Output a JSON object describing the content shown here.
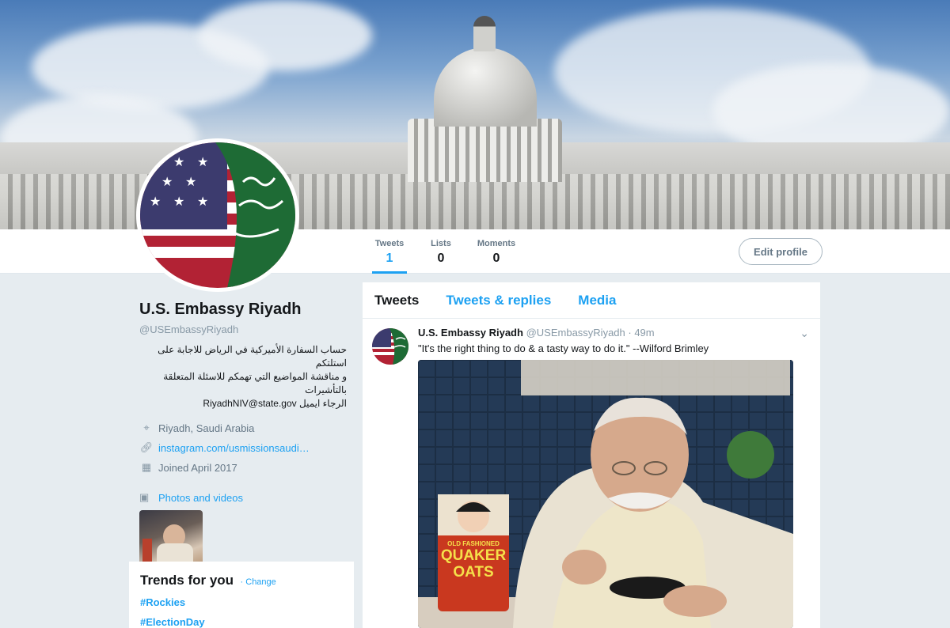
{
  "profile": {
    "name": "U.S. Embassy Riyadh",
    "handle": "@USEmbassyRiyadh",
    "bio_line1": "حساب السفارة الأميركية في الرياض للاجابة على استلتكم",
    "bio_line2": "و مناقشة المواضيع التي تهمكم للاسئلة المتعلقة بالتأشيرات",
    "bio_line3": "الرجاء ايميل RiyadhNIV@state.gov",
    "location": "Riyadh, Saudi Arabia",
    "website": "instagram.com/usmissionsaudi…",
    "joined": "Joined April 2017",
    "photos_label": "Photos and videos"
  },
  "nav": {
    "stats": [
      {
        "label": "Tweets",
        "value": "1"
      },
      {
        "label": "Lists",
        "value": "0"
      },
      {
        "label": "Moments",
        "value": "0"
      }
    ],
    "edit_profile": "Edit profile"
  },
  "timeline": {
    "tabs": [
      "Tweets",
      "Tweets & replies",
      "Media"
    ]
  },
  "tweet": {
    "name": "U.S. Embassy Riyadh",
    "handle": "@USEmbassyRiyadh",
    "time": "· 49m",
    "text": "\"It's the right thing to do & a tasty way to do it.\" --Wilford Brimley"
  },
  "media": {
    "can_line1": "OLD FASHIONED",
    "can_line2": "QUAKER",
    "can_line3": "OATS"
  },
  "trends": {
    "title": "Trends for you",
    "change": "· Change",
    "items": [
      "#Rockies",
      "#ElectionDay"
    ]
  },
  "colors": {
    "accent": "#1da1f2",
    "muted": "#657786",
    "background": "#e6ecf0"
  },
  "icons": {
    "location": "location-pin-icon",
    "link": "link-icon",
    "calendar": "calendar-icon",
    "photos": "photo-icon",
    "caret": "chevron-down-icon"
  }
}
